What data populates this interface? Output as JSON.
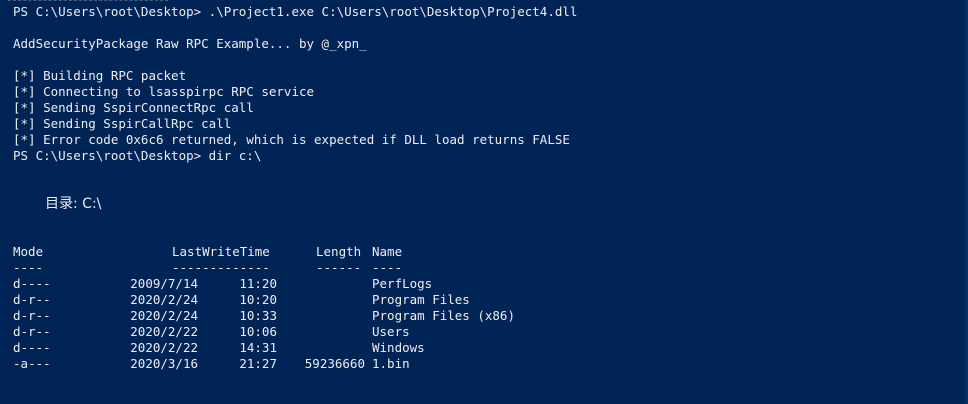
{
  "console": {
    "lines": [
      "PS C:\\Users\\root\\Desktop> .\\Project1.exe C:\\Users\\root\\Desktop\\Project4.dll",
      "",
      "AddSecurityPackage Raw RPC Example... by @_xpn_",
      "",
      "[*] Building RPC packet",
      "[*] Connecting to lsasspirpc RPC service",
      "[*] Sending SspirConnectRpc call",
      "[*] Sending SspirCallRpc call",
      "[*] Error code 0x6c6 returned, which is expected if DLL load returns FALSE",
      "PS C:\\Users\\root\\Desktop> dir c:\\"
    ],
    "directory_label": "目录: C:\\"
  },
  "listing": {
    "headers": {
      "mode": "Mode",
      "last_write_time": "LastWriteTime",
      "length": "Length",
      "name": "Name"
    },
    "underlines": {
      "mode": "----",
      "last_write_time": "-------------",
      "length": "------",
      "name": "----"
    },
    "rows": [
      {
        "mode": "d----",
        "date": "2009/7/14",
        "time": "11:20",
        "length": "",
        "name": "PerfLogs"
      },
      {
        "mode": "d-r--",
        "date": "2020/2/24",
        "time": "10:20",
        "length": "",
        "name": "Program Files"
      },
      {
        "mode": "d-r--",
        "date": "2020/2/24",
        "time": "10:33",
        "length": "",
        "name": "Program Files (x86)"
      },
      {
        "mode": "d-r--",
        "date": "2020/2/22",
        "time": "10:06",
        "length": "",
        "name": "Users"
      },
      {
        "mode": "d----",
        "date": "2020/2/22",
        "time": "14:31",
        "length": "",
        "name": "Windows"
      },
      {
        "mode": "-a---",
        "date": "2020/3/16",
        "time": "21:27",
        "length": "59236660",
        "name": "1.bin"
      }
    ]
  },
  "colors": {
    "background": "#012456",
    "foreground": "#eeedf0"
  }
}
